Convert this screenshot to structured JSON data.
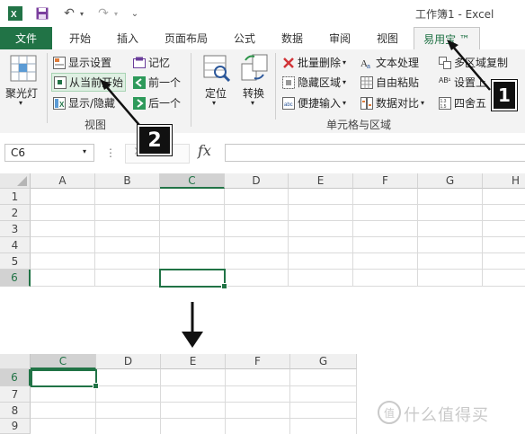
{
  "titlebar": {
    "title": "工作簿1 - Excel",
    "undo_symbol": "↶",
    "redo_symbol": "↷",
    "customize_symbol": "⌄"
  },
  "tabs": {
    "file": "文件",
    "items": [
      "开始",
      "插入",
      "页面布局",
      "公式",
      "数据",
      "审阅",
      "视图"
    ],
    "active": "易用宝 ™"
  },
  "ribbon": {
    "spotlight_label": "聚光灯",
    "view_group": {
      "show_settings": "显示设置",
      "start_from_current": "从当前开始",
      "show_hide": "显示/隐藏",
      "memo": "记忆",
      "previous": "前一个",
      "next": "后一个",
      "label": "视图"
    },
    "locate_label": "定位",
    "convert_label": "转换",
    "cells_group": {
      "batch_delete": "批量删除",
      "hide_area": "隐藏区域",
      "quick_input": "便捷输入",
      "text_process": "文本处理",
      "free_paste": "自由粘贴",
      "data_compare": "数据对比",
      "multi_copy": "多区域复制",
      "set_top": "设置上",
      "round": "四舍五",
      "label": "单元格与区域"
    }
  },
  "formula_bar": {
    "name_box": "C6",
    "fx": "fx",
    "more": "⋮",
    "value": ""
  },
  "grid_top": {
    "columns": [
      "A",
      "B",
      "C",
      "D",
      "E",
      "F",
      "G",
      "H"
    ],
    "rows": [
      "1",
      "2",
      "3",
      "4",
      "5",
      "6"
    ],
    "selected_cell": "C6"
  },
  "arrow_symbol": "▼",
  "grid_bottom": {
    "columns": [
      "C",
      "D",
      "E",
      "F",
      "G"
    ],
    "rows": [
      "6",
      "7",
      "8",
      "9"
    ]
  },
  "annotations": {
    "badge1": "1",
    "badge2": "2"
  },
  "watermark": {
    "symbol": "值",
    "text": "什么值得买"
  },
  "colors": {
    "accent": "#217346",
    "header_bg": "#f0f0f0",
    "ribbon_bg": "#f3f3f3"
  }
}
